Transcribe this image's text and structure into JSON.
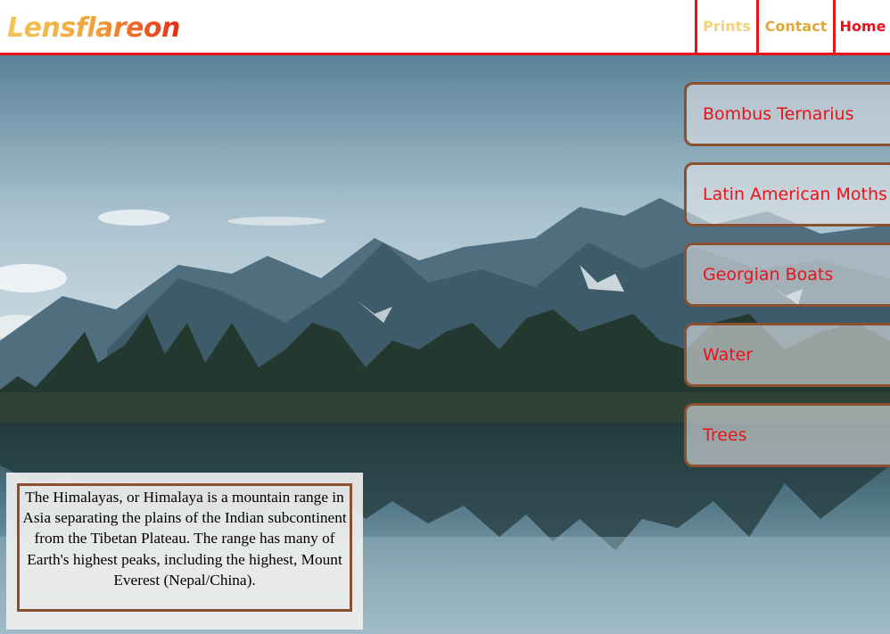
{
  "site": {
    "logo_text": "Lensflareon"
  },
  "nav": {
    "items": [
      {
        "label": "Prints",
        "color": "#f3d27a"
      },
      {
        "label": "Contact",
        "color": "#e0a73c"
      },
      {
        "label": "Home",
        "color": "#e8141b"
      }
    ]
  },
  "colors": {
    "accent_red": "#e8141b",
    "border_brown": "#8a5130"
  },
  "side_menu": {
    "items": [
      {
        "label": "Bombus Ternarius"
      },
      {
        "label": "Latin American Moths"
      },
      {
        "label": "Georgian Boats"
      },
      {
        "label": "Water"
      },
      {
        "label": "Trees"
      }
    ]
  },
  "caption": {
    "text": "The Himalayas, or Himalaya is a mountain range in Asia separating the plains of the Indian subcontinent from the Tibetan Plateau. The range has many of Earth's highest peaks, including the highest, Mount Everest (Nepal/China)."
  }
}
